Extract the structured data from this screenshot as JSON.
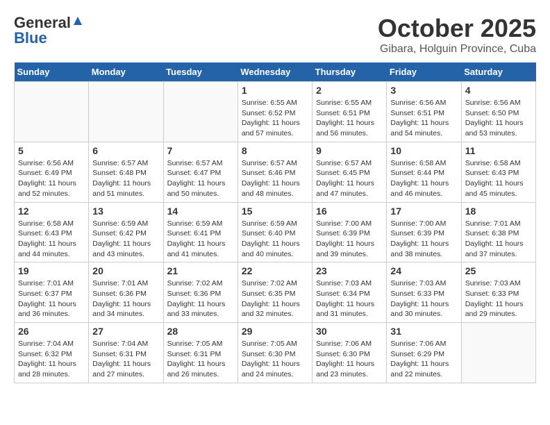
{
  "header": {
    "logo_general": "General",
    "logo_blue": "Blue",
    "month": "October 2025",
    "location": "Gibara, Holguin Province, Cuba"
  },
  "days_of_week": [
    "Sunday",
    "Monday",
    "Tuesday",
    "Wednesday",
    "Thursday",
    "Friday",
    "Saturday"
  ],
  "weeks": [
    [
      {
        "day": "",
        "info": ""
      },
      {
        "day": "",
        "info": ""
      },
      {
        "day": "",
        "info": ""
      },
      {
        "day": "1",
        "info": "Sunrise: 6:55 AM\nSunset: 6:52 PM\nDaylight: 11 hours and 57 minutes."
      },
      {
        "day": "2",
        "info": "Sunrise: 6:55 AM\nSunset: 6:51 PM\nDaylight: 11 hours and 56 minutes."
      },
      {
        "day": "3",
        "info": "Sunrise: 6:56 AM\nSunset: 6:51 PM\nDaylight: 11 hours and 54 minutes."
      },
      {
        "day": "4",
        "info": "Sunrise: 6:56 AM\nSunset: 6:50 PM\nDaylight: 11 hours and 53 minutes."
      }
    ],
    [
      {
        "day": "5",
        "info": "Sunrise: 6:56 AM\nSunset: 6:49 PM\nDaylight: 11 hours and 52 minutes."
      },
      {
        "day": "6",
        "info": "Sunrise: 6:57 AM\nSunset: 6:48 PM\nDaylight: 11 hours and 51 minutes."
      },
      {
        "day": "7",
        "info": "Sunrise: 6:57 AM\nSunset: 6:47 PM\nDaylight: 11 hours and 50 minutes."
      },
      {
        "day": "8",
        "info": "Sunrise: 6:57 AM\nSunset: 6:46 PM\nDaylight: 11 hours and 48 minutes."
      },
      {
        "day": "9",
        "info": "Sunrise: 6:57 AM\nSunset: 6:45 PM\nDaylight: 11 hours and 47 minutes."
      },
      {
        "day": "10",
        "info": "Sunrise: 6:58 AM\nSunset: 6:44 PM\nDaylight: 11 hours and 46 minutes."
      },
      {
        "day": "11",
        "info": "Sunrise: 6:58 AM\nSunset: 6:43 PM\nDaylight: 11 hours and 45 minutes."
      }
    ],
    [
      {
        "day": "12",
        "info": "Sunrise: 6:58 AM\nSunset: 6:43 PM\nDaylight: 11 hours and 44 minutes."
      },
      {
        "day": "13",
        "info": "Sunrise: 6:59 AM\nSunset: 6:42 PM\nDaylight: 11 hours and 43 minutes."
      },
      {
        "day": "14",
        "info": "Sunrise: 6:59 AM\nSunset: 6:41 PM\nDaylight: 11 hours and 41 minutes."
      },
      {
        "day": "15",
        "info": "Sunrise: 6:59 AM\nSunset: 6:40 PM\nDaylight: 11 hours and 40 minutes."
      },
      {
        "day": "16",
        "info": "Sunrise: 7:00 AM\nSunset: 6:39 PM\nDaylight: 11 hours and 39 minutes."
      },
      {
        "day": "17",
        "info": "Sunrise: 7:00 AM\nSunset: 6:39 PM\nDaylight: 11 hours and 38 minutes."
      },
      {
        "day": "18",
        "info": "Sunrise: 7:01 AM\nSunset: 6:38 PM\nDaylight: 11 hours and 37 minutes."
      }
    ],
    [
      {
        "day": "19",
        "info": "Sunrise: 7:01 AM\nSunset: 6:37 PM\nDaylight: 11 hours and 36 minutes."
      },
      {
        "day": "20",
        "info": "Sunrise: 7:01 AM\nSunset: 6:36 PM\nDaylight: 11 hours and 34 minutes."
      },
      {
        "day": "21",
        "info": "Sunrise: 7:02 AM\nSunset: 6:36 PM\nDaylight: 11 hours and 33 minutes."
      },
      {
        "day": "22",
        "info": "Sunrise: 7:02 AM\nSunset: 6:35 PM\nDaylight: 11 hours and 32 minutes."
      },
      {
        "day": "23",
        "info": "Sunrise: 7:03 AM\nSunset: 6:34 PM\nDaylight: 11 hours and 31 minutes."
      },
      {
        "day": "24",
        "info": "Sunrise: 7:03 AM\nSunset: 6:33 PM\nDaylight: 11 hours and 30 minutes."
      },
      {
        "day": "25",
        "info": "Sunrise: 7:03 AM\nSunset: 6:33 PM\nDaylight: 11 hours and 29 minutes."
      }
    ],
    [
      {
        "day": "26",
        "info": "Sunrise: 7:04 AM\nSunset: 6:32 PM\nDaylight: 11 hours and 28 minutes."
      },
      {
        "day": "27",
        "info": "Sunrise: 7:04 AM\nSunset: 6:31 PM\nDaylight: 11 hours and 27 minutes."
      },
      {
        "day": "28",
        "info": "Sunrise: 7:05 AM\nSunset: 6:31 PM\nDaylight: 11 hours and 26 minutes."
      },
      {
        "day": "29",
        "info": "Sunrise: 7:05 AM\nSunset: 6:30 PM\nDaylight: 11 hours and 24 minutes."
      },
      {
        "day": "30",
        "info": "Sunrise: 7:06 AM\nSunset: 6:30 PM\nDaylight: 11 hours and 23 minutes."
      },
      {
        "day": "31",
        "info": "Sunrise: 7:06 AM\nSunset: 6:29 PM\nDaylight: 11 hours and 22 minutes."
      },
      {
        "day": "",
        "info": ""
      }
    ]
  ]
}
